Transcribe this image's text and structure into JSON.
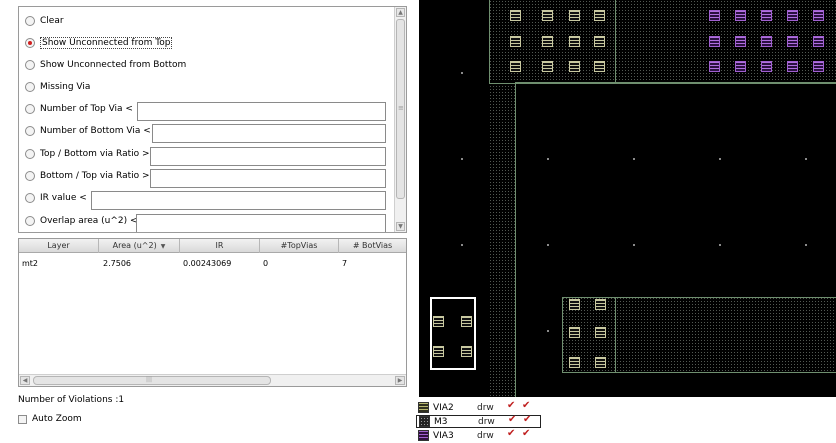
{
  "options": [
    {
      "label": "Clear",
      "selected": false
    },
    {
      "label": "Show Unconnected from Top",
      "selected": true
    },
    {
      "label": "Show Unconnected from Bottom",
      "selected": false
    },
    {
      "label": "Missing Via",
      "selected": false
    },
    {
      "label": "Number of Top Via <",
      "selected": false,
      "value": ""
    },
    {
      "label": "Number of Bottom Via <",
      "selected": false,
      "value": ""
    },
    {
      "label": "Top / Bottom via Ratio >",
      "selected": false,
      "value": ""
    },
    {
      "label": "Bottom / Top via Ratio >",
      "selected": false,
      "value": ""
    },
    {
      "label": "IR value <",
      "selected": false,
      "value": ""
    },
    {
      "label": "Overlap area (u^2) <",
      "selected": false,
      "value": ""
    }
  ],
  "table": {
    "columns": [
      "Layer",
      "Area (u^2)",
      "IR",
      "#TopVias",
      "# BotVias"
    ],
    "rows": [
      [
        "mt2",
        "2.7506",
        "0.00243069",
        "0",
        "7"
      ]
    ]
  },
  "status": {
    "violations": "Number of Violations :1"
  },
  "auto_zoom": {
    "label": "Auto Zoom",
    "checked": false
  },
  "layers": [
    {
      "name": "VIA2",
      "purpose": "drw",
      "visible": true,
      "selectable": true,
      "selected": false
    },
    {
      "name": "M3",
      "purpose": "drw",
      "visible": true,
      "selectable": true,
      "selected": true
    },
    {
      "name": "VIA3",
      "purpose": "drw",
      "visible": true,
      "selectable": true,
      "selected": false
    }
  ],
  "colors": {
    "canvas_bg": "#000000",
    "via2": "#c8c8a0",
    "via3": "#b070e0",
    "metal_edge": "#6f8f6f",
    "selection": "#ffffff",
    "check_mark": "#c02020"
  }
}
